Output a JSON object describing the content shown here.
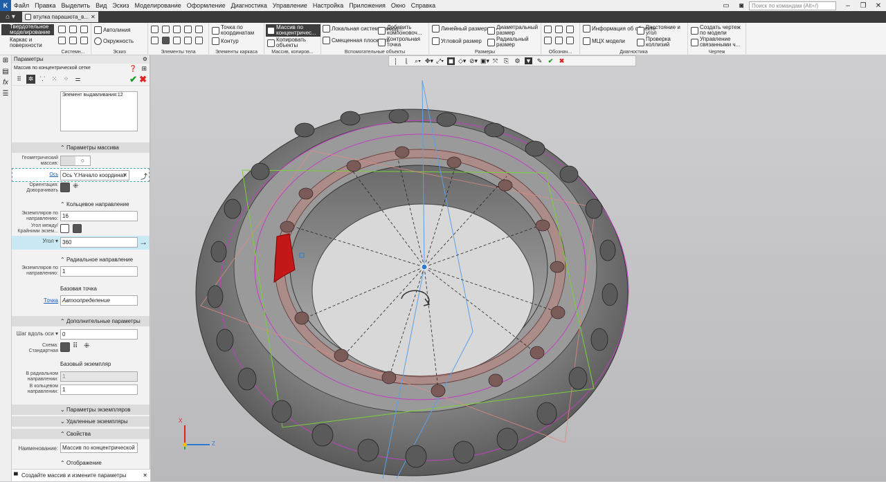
{
  "menu": {
    "items": [
      "Файл",
      "Правка",
      "Выделить",
      "Вид",
      "Эскиз",
      "Моделирование",
      "Оформление",
      "Диагностика",
      "Управление",
      "Настройка",
      "Приложения",
      "Окно",
      "Справка"
    ],
    "search_placeholder": "Поиск по командам (Alt+/)"
  },
  "tabs": {
    "doc_tab": "втулка парашюта_в..."
  },
  "ribbon": {
    "mode_buttons": [
      "Твердотельное моделирование",
      "Каркас и поверхности"
    ],
    "system": {
      "label": "Системн..."
    },
    "sketch": {
      "label": "Эскиз",
      "autoline": "Автолиния",
      "circle": "Окружность"
    },
    "body": {
      "label": "Элементы тела"
    },
    "frame": {
      "label": "Элементы каркаса",
      "point_coords": "Точка по координатам",
      "contour": "Контур"
    },
    "arrays": {
      "label": "Массив, копиров...",
      "concentric": "Массив по концентричес...",
      "copy_objects": "Копировать объекты"
    },
    "aux": {
      "label": "Вспомогательные объекты",
      "local_cs": "Локальная система коорд...",
      "offset_plane": "Смещенная плоскость",
      "add_component": "Добавить компоновоч...",
      "control_point": "Контрольная точка"
    },
    "dims": {
      "label": "Размеры",
      "linear": "Линейный размер",
      "angular": "Угловой размер",
      "diametral": "Диаметральный размер",
      "radial": "Радиальный размер"
    },
    "notation": {
      "label": "Обознач..."
    },
    "diag": {
      "label": "Диагностика",
      "object_info": "Информация об объекте",
      "mcx": "МЦХ модели",
      "distance_angle": "Расстояние и угол",
      "collision": "Проверка коллизий"
    },
    "drawing": {
      "label": "Чертеж",
      "create_drawing": "Создать чертеж по модели",
      "manage_linked": "Управление связанными ч..."
    }
  },
  "panel": {
    "title": "Параметры",
    "subtitle": "Массив по концентрической сетке",
    "list_item": "Элемент выдавливания:12",
    "sec_array_params": "Параметры массива",
    "geom_array_label": "Геометрический массив:",
    "axis_label": "Ось",
    "axis_value": "Ось Y.Начало координат",
    "orientation_label": "Ориентация: Доворачивать",
    "ring_dir": "Кольцевое направление",
    "count_label": "Экземпляров по направлению:",
    "ring_count": "16",
    "angle_between_label": "Угол между/ Крайними экзем...",
    "angle_label": "Угол",
    "angle_value": "360",
    "radial_dir": "Радиальное направление",
    "radial_count": "1",
    "base_point": "Базовая точка",
    "point_label": "Точка",
    "point_value": "Автоопределение",
    "sec_extra": "Дополнительные параметры",
    "step_label": "Шаг вдоль оси",
    "step_value": "0",
    "scheme_label": "Схема: Стандартная",
    "base_instance": "Базовый экземпляр",
    "radial_inst_label": "В радиальном направлении:",
    "radial_inst_value": "1",
    "ring_inst_label": "В кольцевом направлении:",
    "ring_inst_value": "1",
    "sec_instance_params": "Параметры экземпляров",
    "sec_deleted": "Удаленные экземпляры",
    "sec_props": "Свойства",
    "name_label": "Наименование:",
    "name_value": "Массив по концентрической",
    "sec_display": "Отображение"
  },
  "status": {
    "text": "Создайте массив и измените параметры"
  },
  "viewport": {
    "axis_x": "X",
    "axis_z": "Z"
  },
  "colors": {
    "accent": "#3d3d3d",
    "highlight": "#c9e9f5",
    "model_lines": "#c040c0",
    "selection": "#cc1111"
  }
}
